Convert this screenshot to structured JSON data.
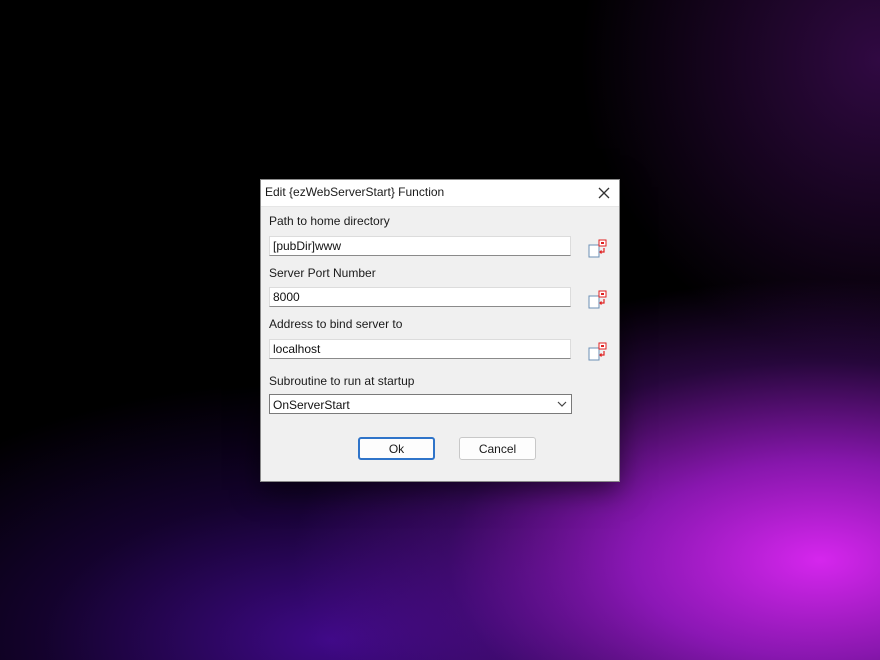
{
  "dialog": {
    "title": "Edit {ezWebServerStart} Function",
    "fields": [
      {
        "label": "Path to home directory",
        "value": "[pubDir]www"
      },
      {
        "label": "Server Port Number",
        "value": "8000"
      },
      {
        "label": "Address to bind server to",
        "value": "localhost"
      }
    ],
    "startup": {
      "label": "Subroutine to run at startup",
      "value": "OnServerStart"
    },
    "buttons": {
      "ok": "Ok",
      "cancel": "Cancel"
    }
  },
  "icons": {
    "close": "close-icon",
    "variable_insert": "insert-variable-icon",
    "dropdown": "chevron-down-icon"
  },
  "colors": {
    "default_button_border": "#2f74c9",
    "variable_icon_accent": "#e02020"
  }
}
